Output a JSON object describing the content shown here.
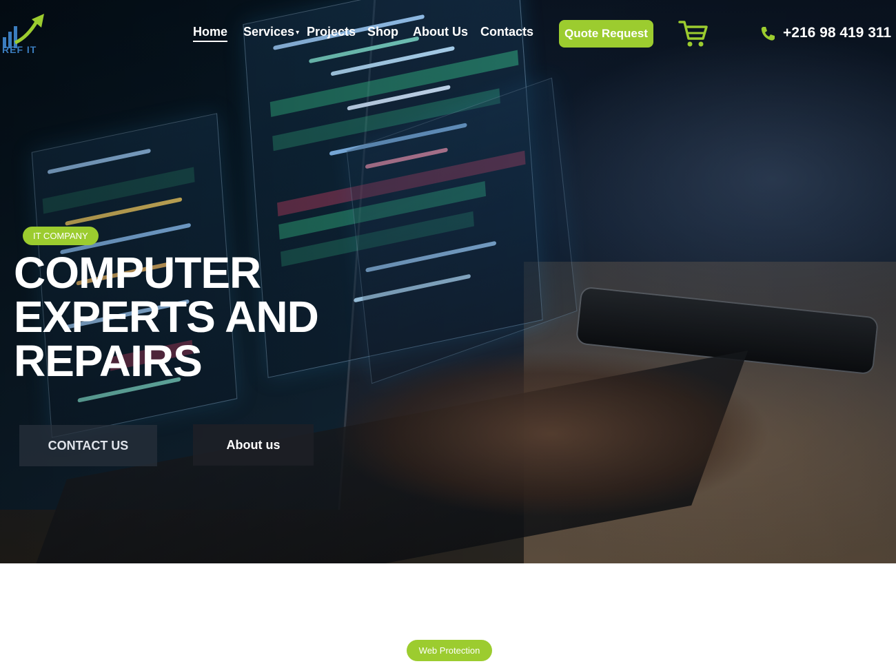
{
  "brand": {
    "logo_text": "REF IT"
  },
  "nav": {
    "items": [
      {
        "label": "Home",
        "active": true
      },
      {
        "label": "Services",
        "has_dropdown": true
      },
      {
        "label": "Projects"
      },
      {
        "label": "Shop"
      },
      {
        "label": "About Us"
      },
      {
        "label": "Contacts"
      }
    ]
  },
  "header": {
    "quote_button": "Quote Request",
    "cart_icon": "shopping-cart-icon",
    "phone_icon": "phone-icon",
    "phone": "+216 98 419 311"
  },
  "hero": {
    "tag": "IT COMPANY",
    "headline": [
      "COMPUTER",
      "EXPERTS AND",
      "REPAIRS"
    ],
    "contact_button": "CONTACT US",
    "about_button": "About us"
  },
  "section": {
    "pill": "Web Protection"
  },
  "colors": {
    "accent": "#9ccc2f",
    "logo_blue": "#3b7dbf",
    "text_light": "#ffffff"
  }
}
